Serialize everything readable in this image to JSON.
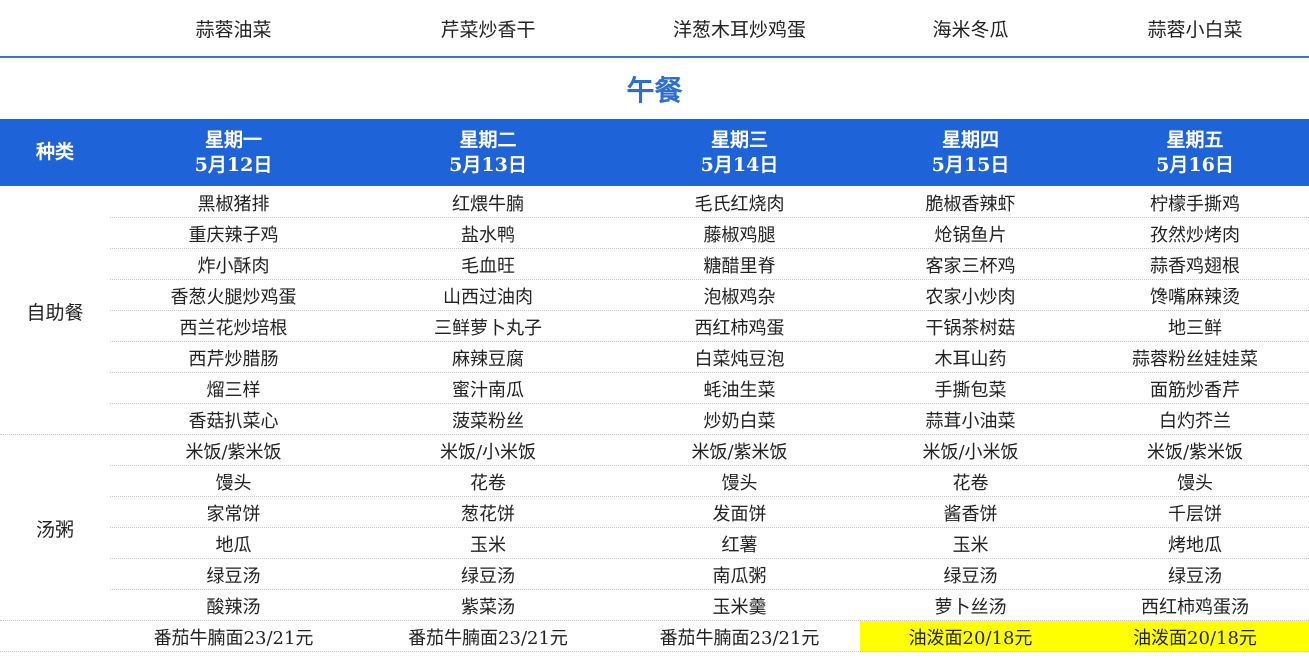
{
  "top_row": [
    "蒜蓉油菜",
    "芹菜炒香干",
    "洋葱木耳炒鸡蛋",
    "海米冬瓜",
    "蒜蓉小白菜"
  ],
  "section_title": "午餐",
  "header": {
    "category": "种类",
    "days": [
      {
        "weekday": "星期一",
        "date": "5月12日"
      },
      {
        "weekday": "星期二",
        "date": "5月13日"
      },
      {
        "weekday": "星期三",
        "date": "5月14日"
      },
      {
        "weekday": "星期四",
        "date": "5月15日"
      },
      {
        "weekday": "星期五",
        "date": "5月16日"
      }
    ]
  },
  "groups": [
    {
      "name": "自助餐",
      "rows": [
        [
          "黑椒猪排",
          "红煨牛腩",
          "毛氏红烧肉",
          "脆椒香辣虾",
          "柠檬手撕鸡"
        ],
        [
          "重庆辣子鸡",
          "盐水鸭",
          "藤椒鸡腿",
          "炝锅鱼片",
          "孜然炒烤肉"
        ],
        [
          "炸小酥肉",
          "毛血旺",
          "糖醋里脊",
          "客家三杯鸡",
          "蒜香鸡翅根"
        ],
        [
          "香葱火腿炒鸡蛋",
          "山西过油肉",
          "泡椒鸡杂",
          "农家小炒肉",
          "馋嘴麻辣烫"
        ],
        [
          "西兰花炒培根",
          "三鲜萝卜丸子",
          "西红柿鸡蛋",
          "干锅茶树菇",
          "地三鲜"
        ],
        [
          "西芹炒腊肠",
          "麻辣豆腐",
          "白菜炖豆泡",
          "木耳山药",
          "蒜蓉粉丝娃娃菜"
        ],
        [
          "熘三样",
          "蜜汁南瓜",
          "蚝油生菜",
          "手撕包菜",
          "面筋炒香芹"
        ],
        [
          "香菇扒菜心",
          "菠菜粉丝",
          "炒奶白菜",
          "蒜茸小油菜",
          "白灼芥兰"
        ]
      ]
    },
    {
      "name": "汤粥",
      "rows": [
        [
          "米饭/紫米饭",
          "米饭/小米饭",
          "米饭/紫米饭",
          "米饭/小米饭",
          "米饭/紫米饭"
        ],
        [
          "馒头",
          "花卷",
          "馒头",
          "花卷",
          "馒头"
        ],
        [
          "家常饼",
          "葱花饼",
          "发面饼",
          "酱香饼",
          "千层饼"
        ],
        [
          "地瓜",
          "玉米",
          "红薯",
          "玉米",
          "烤地瓜"
        ],
        [
          "绿豆汤",
          "绿豆汤",
          "南瓜粥",
          "绿豆汤",
          "绿豆汤"
        ],
        [
          "酸辣汤",
          "紫菜汤",
          "玉米羹",
          "萝卜丝汤",
          "西红柿鸡蛋汤"
        ]
      ]
    }
  ],
  "noodle_row": [
    "番茄牛腩面23/21元",
    "番茄牛腩面23/21元",
    "番茄牛腩面23/21元",
    "油泼面20/18元",
    "油泼面20/18元"
  ],
  "highlight_color": "#ffff00",
  "header_color": "#1f63d9"
}
